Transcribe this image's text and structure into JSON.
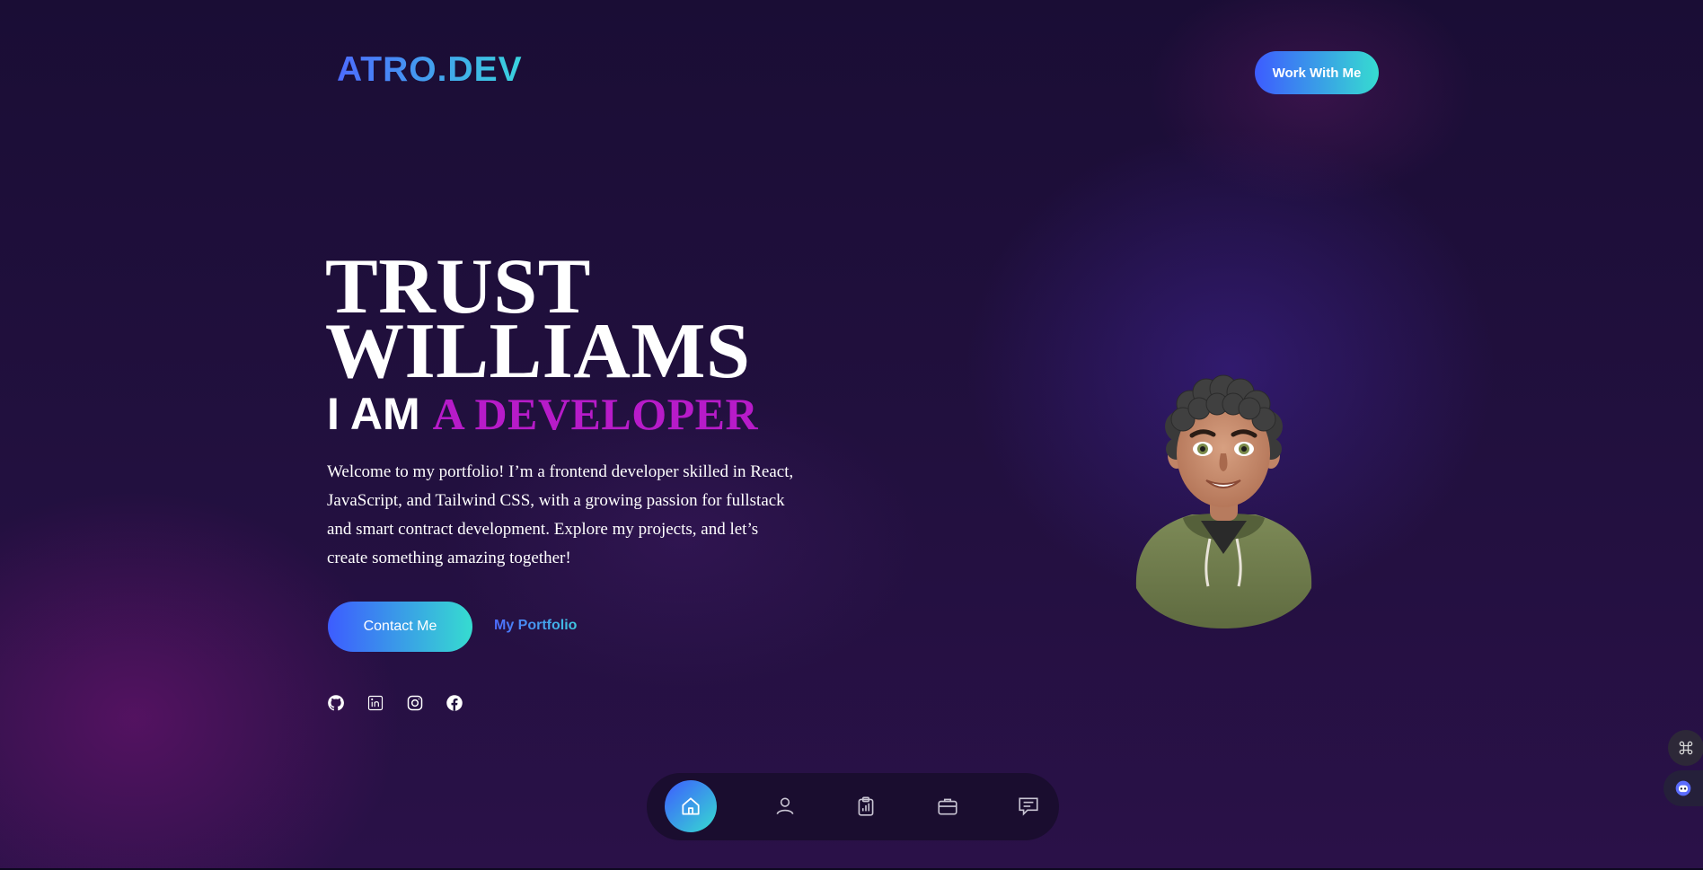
{
  "header": {
    "logo": "ATRO.DEV",
    "cta_label": "Work With Me"
  },
  "hero": {
    "name_line1": "TRUST",
    "name_line2": "WILLIAMS",
    "iam": "I AM",
    "role": "A DEVELOPER",
    "intro": "Welcome to my portfolio! I’m a frontend developer skilled in React, JavaScript, and Tailwind CSS, with a growing passion for fullstack and smart contract development. Explore my projects, and let’s create something amazing together!",
    "contact_label": "Contact Me",
    "portfolio_label": "My Portfolio"
  },
  "socials": [
    "github-icon",
    "linkedin-icon",
    "instagram-icon",
    "facebook-icon"
  ],
  "nav": {
    "items": [
      "home-icon",
      "user-icon",
      "clipboard-chart-icon",
      "briefcase-icon",
      "message-icon"
    ],
    "active": "home-icon"
  },
  "widgets": [
    "command-icon",
    "chatbot-icon"
  ],
  "colors": {
    "accent_start": "#3d5cff",
    "accent_end": "#36dcd0",
    "role_magenta": "#b71bc9",
    "background": "#1c0f38"
  }
}
